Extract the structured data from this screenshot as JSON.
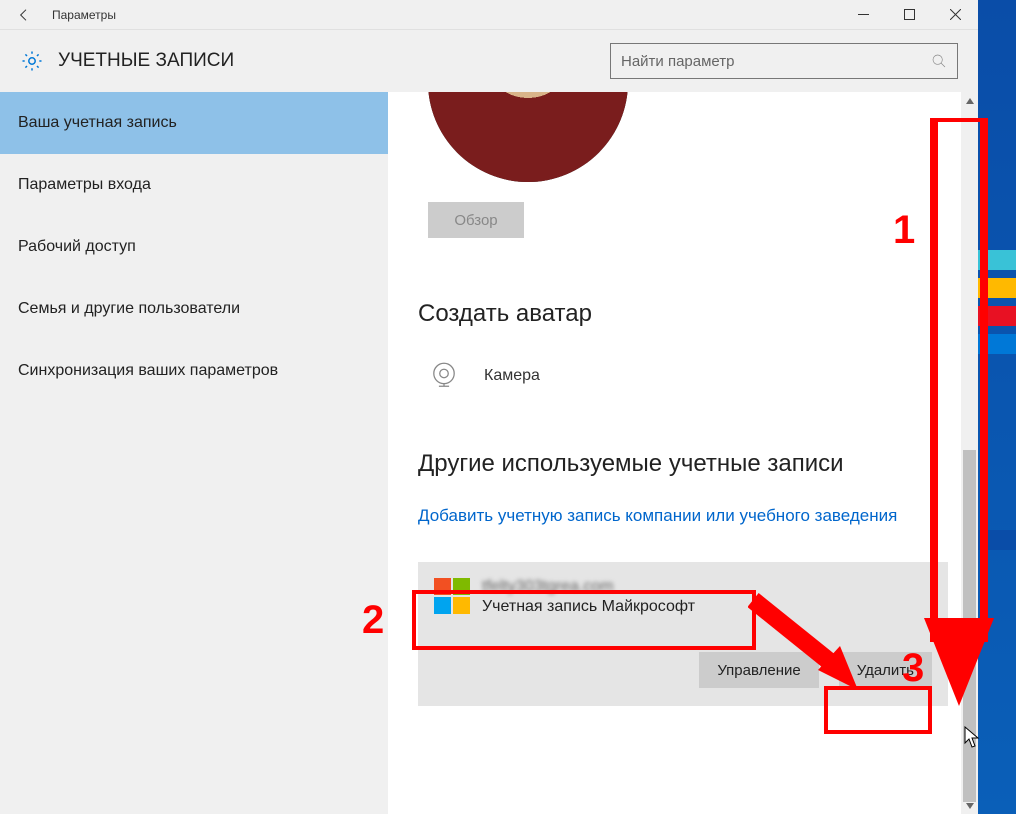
{
  "window": {
    "title": "Параметры"
  },
  "header": {
    "section": "УЧЕТНЫЕ ЗАПИСИ",
    "search_placeholder": "Найти параметр"
  },
  "sidebar": {
    "items": [
      {
        "label": "Ваша учетная запись",
        "active": true
      },
      {
        "label": "Параметры входа"
      },
      {
        "label": "Рабочий доступ"
      },
      {
        "label": "Семья и другие пользователи"
      },
      {
        "label": "Синхронизация ваших параметров"
      }
    ]
  },
  "content": {
    "browse_label": "Обзор",
    "create_avatar_title": "Создать аватар",
    "camera_label": "Камера",
    "other_accounts_title": "Другие используемые учетные записи",
    "add_account_link": "Добавить учетную запись компании или учебного заведения",
    "account": {
      "email": "tfelty303tgrea.com",
      "type": "Учетная запись Майкрософт"
    },
    "manage_label": "Управление",
    "delete_label": "Удалить"
  },
  "annotations": {
    "n1": "1",
    "n2": "2",
    "n3": "3"
  }
}
